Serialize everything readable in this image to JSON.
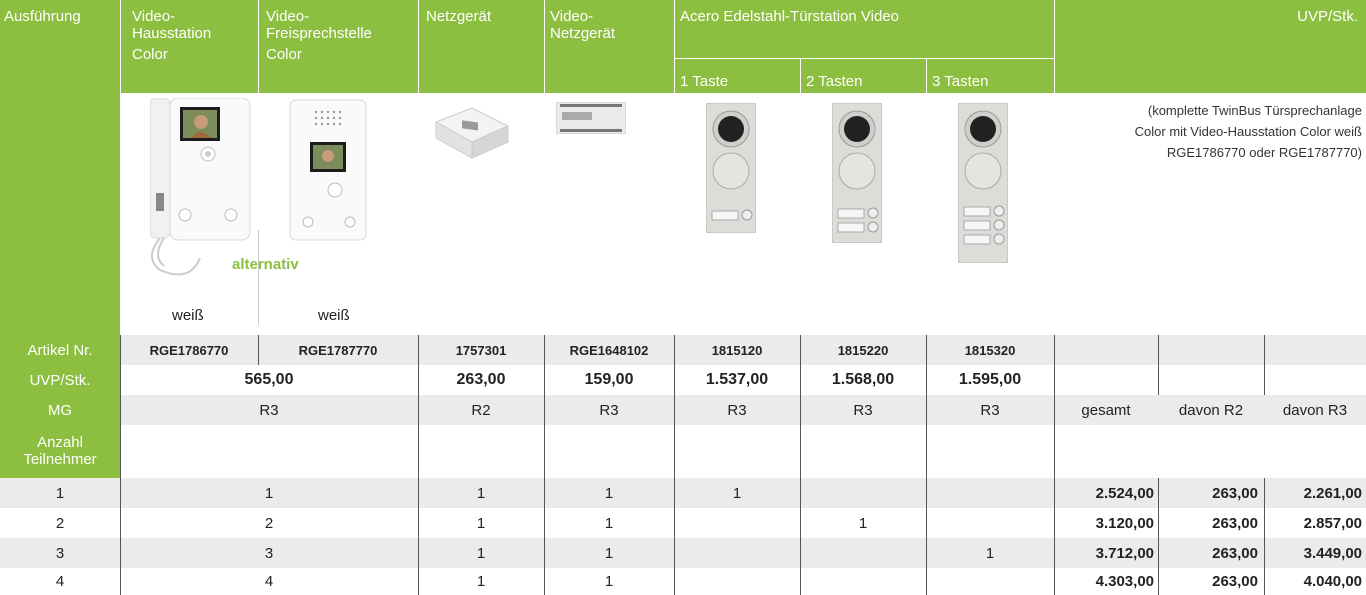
{
  "header": {
    "ausfuehrung": "Ausführung",
    "col1_l1": "Video-",
    "col1_l2": "Hausstation",
    "col1_l3": "Color",
    "col2_l1": "Video-",
    "col2_l2": "Freisprechstelle",
    "col2_l3": "Color",
    "col3": "Netzgerät",
    "col4_l1": "Video-",
    "col4_l2": "Netzgerät",
    "acero": "Acero Edelstahl-Türstation Video",
    "taste1": "1 Taste",
    "taste2": "2 Tasten",
    "taste3": "3 Tasten",
    "uvp": "UVP/Stk."
  },
  "images": {
    "alternativ": "alternativ",
    "weiss1": "weiß",
    "weiss2": "weiß",
    "note_l1": "(komplette TwinBus Türsprechanlage",
    "note_l2": "Color mit Video-Hausstation Color weiß",
    "note_l3": "RGE1786770 oder RGE1787770)"
  },
  "rows": {
    "artikel_label": "Artikel Nr.",
    "artikel": [
      "RGE1786770",
      "RGE1787770",
      "1757301",
      "RGE1648102",
      "1815120",
      "1815220",
      "1815320"
    ],
    "uvp_label": "UVP/Stk.",
    "uvp": [
      "565,00",
      "263,00",
      "159,00",
      "1.537,00",
      "1.568,00",
      "1.595,00"
    ],
    "mg_label": "MG",
    "mg": [
      "R3",
      "R2",
      "R3",
      "R3",
      "R3",
      "R3"
    ],
    "mg_right": [
      "gesamt",
      "davon R2",
      "davon R3"
    ],
    "anzahl_l1": "Anzahl",
    "anzahl_l2": "Teilnehmer"
  },
  "data_rows": [
    {
      "n": "1",
      "hs": "1",
      "ng": "1",
      "vng": "1",
      "t1": "1",
      "t2": "",
      "t3": "",
      "gesamt": "2.524,00",
      "r2": "263,00",
      "r3": "2.261,00"
    },
    {
      "n": "2",
      "hs": "2",
      "ng": "1",
      "vng": "1",
      "t1": "",
      "t2": "1",
      "t3": "",
      "gesamt": "3.120,00",
      "r2": "263,00",
      "r3": "2.857,00"
    },
    {
      "n": "3",
      "hs": "3",
      "ng": "1",
      "vng": "1",
      "t1": "",
      "t2": "",
      "t3": "1",
      "gesamt": "3.712,00",
      "r2": "263,00",
      "r3": "3.449,00"
    },
    {
      "n": "4",
      "hs": "4",
      "ng": "1",
      "vng": "1",
      "t1": "",
      "t2": "",
      "t3": "",
      "gesamt": "4.303,00",
      "r2": "263,00",
      "r3": "4.040,00"
    }
  ],
  "colors": {
    "green": "#8cbf3f",
    "grey": "#ebebeb",
    "white": "#ffffff"
  }
}
